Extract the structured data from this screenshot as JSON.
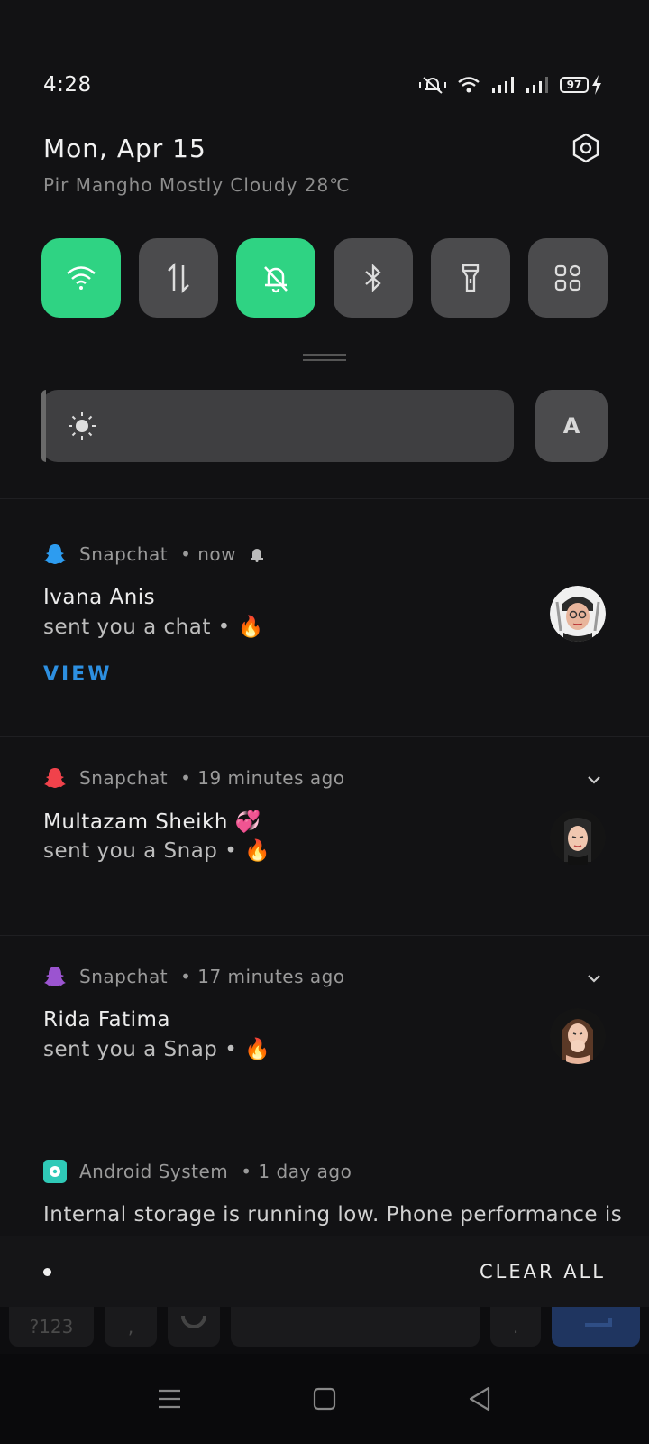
{
  "status": {
    "time": "4:28",
    "battery_level": "97",
    "icons": [
      "mute-icon",
      "wifi-icon",
      "signal-icon",
      "signal-icon",
      "battery-icon",
      "charging-icon"
    ]
  },
  "header": {
    "date": "Mon, Apr 15",
    "weather": "Pir Mangho Mostly Cloudy 28℃"
  },
  "quick_settings": {
    "tiles": [
      {
        "name": "wifi",
        "icon": "wifi-icon",
        "on": true
      },
      {
        "name": "mobile-data",
        "icon": "data-arrows-icon",
        "on": false
      },
      {
        "name": "do-not-disturb",
        "icon": "bell-off-icon",
        "on": true
      },
      {
        "name": "bluetooth",
        "icon": "bluetooth-icon",
        "on": false
      },
      {
        "name": "flashlight",
        "icon": "flashlight-icon",
        "on": false
      },
      {
        "name": "more",
        "icon": "grid-icon",
        "on": false
      }
    ],
    "brightness_level": 0.01,
    "auto_label": "A",
    "accent": "#2fd383"
  },
  "notifications": [
    {
      "app": "Snapchat",
      "time": " • now",
      "icon_color": "#2d9cf0",
      "title": "Ivana Anis",
      "text": "sent you a chat • 🔥",
      "action": "VIEW"
    },
    {
      "app": "Snapchat",
      "time": " • 19 minutes ago",
      "icon_color": "#f0424b",
      "title": "Multazam Sheikh 💞",
      "text": "sent you a Snap • 🔥"
    },
    {
      "app": "Snapchat",
      "time": " • 17 minutes ago",
      "icon_color": "#9b54d0",
      "title": "Rida Fatima",
      "text": "sent you a Snap • 🔥"
    },
    {
      "app": "Android System",
      "time": " • 1 day ago",
      "icon_color": "#2fc9b7",
      "text": "Internal storage is running low. Phone performance is"
    }
  ],
  "footer": {
    "clear_all": "CLEAR ALL"
  },
  "keyboard": {
    "keys": [
      "?123",
      ",",
      "",
      ".",
      ""
    ]
  }
}
